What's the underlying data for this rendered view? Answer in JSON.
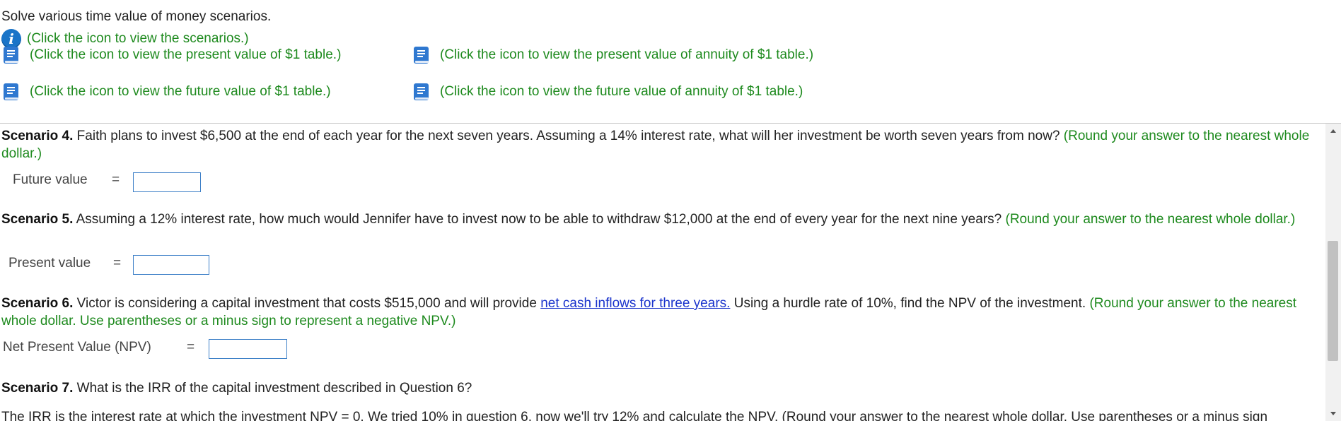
{
  "header": {
    "prompt": "Solve various time value of money scenarios.",
    "scenarios_link": "(Click the icon to view the scenarios.)",
    "pv1_link": "(Click the icon to view the present value of $1 table.)",
    "pva_link": "(Click the icon to view the present value of annuity of $1 table.)",
    "fv1_link": "(Click the icon to view the future value of $1 table.)",
    "fva_link": "(Click the icon to view the future value of annuity of $1 table.)"
  },
  "scenario4": {
    "label": "Scenario 4.",
    "text": " Faith plans to invest $6,500 at the end of each year for the next seven years. Assuming a 14% interest rate, what will her investment be worth seven years from now?",
    "hint": " (Round your answer to the nearest whole dollar.)",
    "answer_label": "Future value",
    "equals": "=",
    "value": ""
  },
  "scenario5": {
    "label": "Scenario 5.",
    "text": " Assuming a 12% interest rate, how much would Jennifer have to invest now to be able to withdraw $12,000 at the end of every year for the next nine years?",
    "hint": " (Round your answer to the nearest whole dollar.)",
    "answer_label": "Present value",
    "equals": "=",
    "value": ""
  },
  "scenario6": {
    "label": "Scenario 6.",
    "text_before": " Victor is considering a capital investment that costs $515,000 and will provide ",
    "link": "net cash inflows for three years.",
    "text_after": " Using a hurdle rate of 10%, find the NPV of the investment.",
    "hint": " (Round your answer to the nearest whole dollar. Use parentheses or a minus sign to represent a negative NPV.)",
    "answer_label": "Net Present Value (NPV)",
    "equals": "=",
    "value": ""
  },
  "scenario7": {
    "label": "Scenario 7.",
    "text": " What is the IRR of the capital investment described in Question 6?",
    "partial_line": "The IRR is the interest rate at which the investment NPV = 0. We tried 10% in question 6, now we'll try 12% and calculate the NPV. (Round your answer to the nearest whole dollar. Use parentheses or a minus sign"
  },
  "colors": {
    "hint_green": "#1e8a1e",
    "link_blue": "#1a33cc",
    "info_icon_blue": "#1a74c8",
    "input_border": "#3c7fc7"
  },
  "icons": {
    "info": "info-icon",
    "table": "book-icon"
  }
}
